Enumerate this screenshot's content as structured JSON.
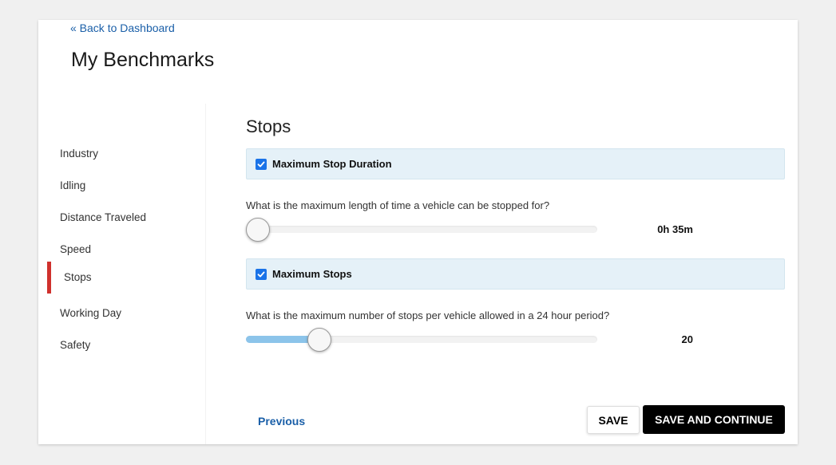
{
  "header": {
    "back_link": "« Back to Dashboard",
    "title": "My Benchmarks"
  },
  "sidebar": {
    "items": [
      {
        "label": "Industry",
        "active": false
      },
      {
        "label": "Idling",
        "active": false
      },
      {
        "label": "Distance Traveled",
        "active": false
      },
      {
        "label": "Speed",
        "active": false
      },
      {
        "label": "Stops",
        "active": true
      },
      {
        "label": "Working Day",
        "active": false
      },
      {
        "label": "Safety",
        "active": false
      }
    ]
  },
  "main": {
    "section_title": "Stops",
    "benchmarks": [
      {
        "label": "Maximum Stop Duration",
        "checked": true,
        "question": "What is the maximum length of time a vehicle can be stopped for?",
        "value": "0h 35m",
        "slider_fraction": 0.0
      },
      {
        "label": "Maximum Stops",
        "checked": true,
        "question": "What is the maximum number of stops per vehicle allowed in a 24 hour period?",
        "value": "20",
        "slider_fraction": 0.21
      }
    ]
  },
  "footer": {
    "previous_label": "Previous",
    "save_label": "SAVE",
    "save_continue_label": "SAVE AND CONTINUE"
  },
  "colors": {
    "accent_link": "#1a5fa8",
    "active_indicator": "#d0312d",
    "panel_background": "#e5f1f8",
    "checkbox": "#1a73e8",
    "slider_fill": "#8cc4ea",
    "primary_button": "#000000"
  },
  "icons": {
    "checkbox": "check-icon"
  }
}
